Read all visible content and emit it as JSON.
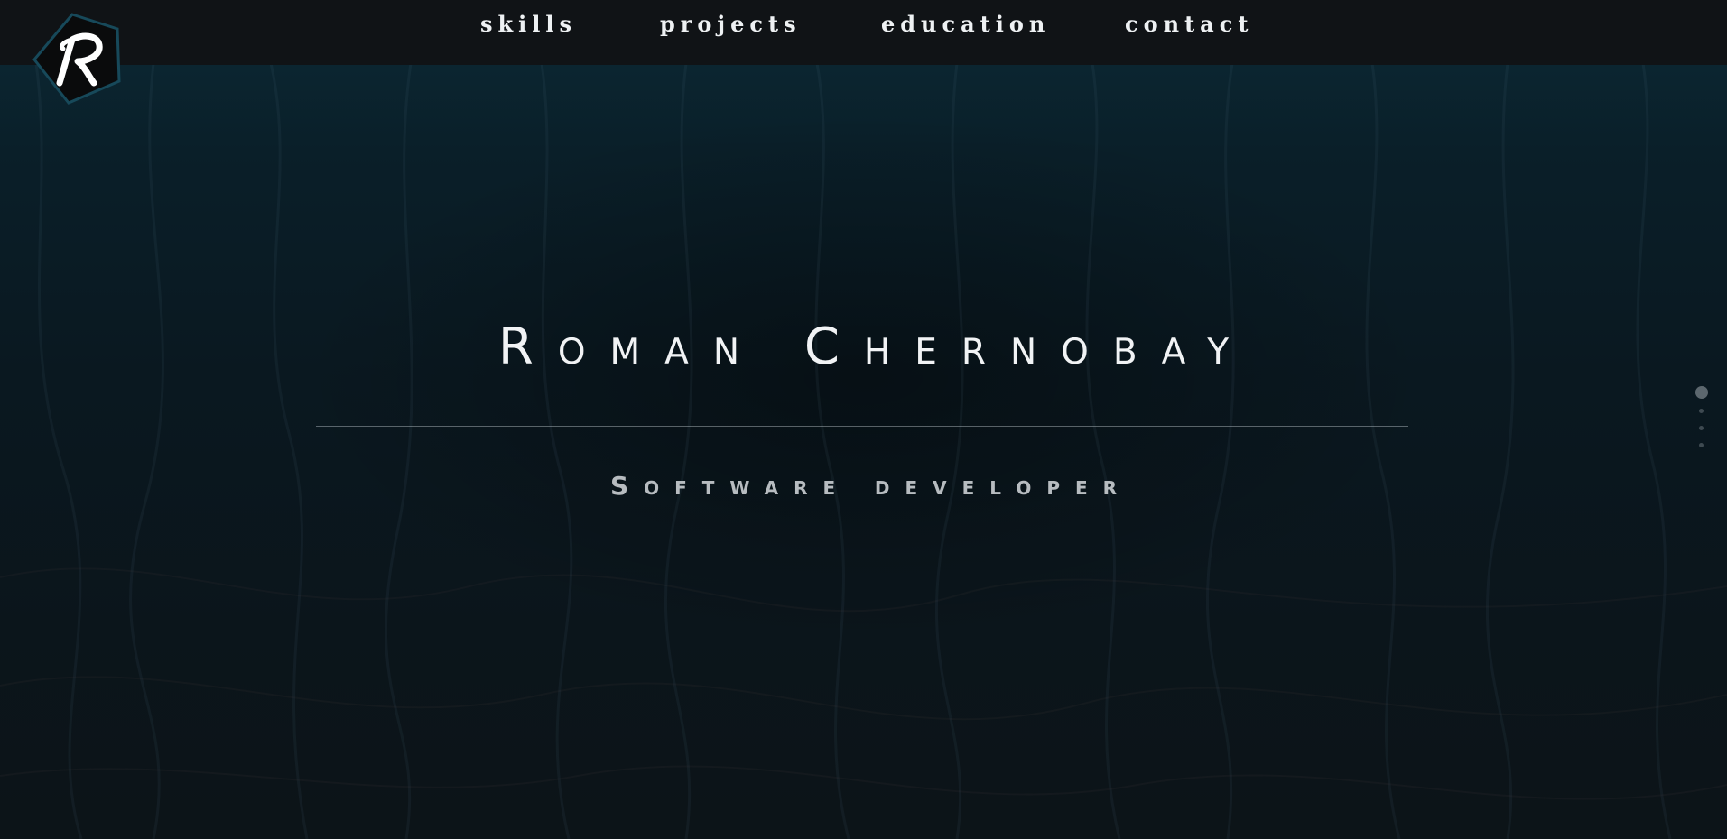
{
  "header": {
    "logo_letter": "R",
    "nav": {
      "skills": "skills",
      "projects": "projects",
      "education": "education",
      "contact": "contact"
    }
  },
  "hero": {
    "name": "Roman Chernobay",
    "role": "Software developer"
  },
  "colors": {
    "navbar_bg": "#111315",
    "text_primary": "#f1f3f5",
    "text_secondary": "#b7bcc0",
    "accent_teal": "#0c2a36"
  }
}
